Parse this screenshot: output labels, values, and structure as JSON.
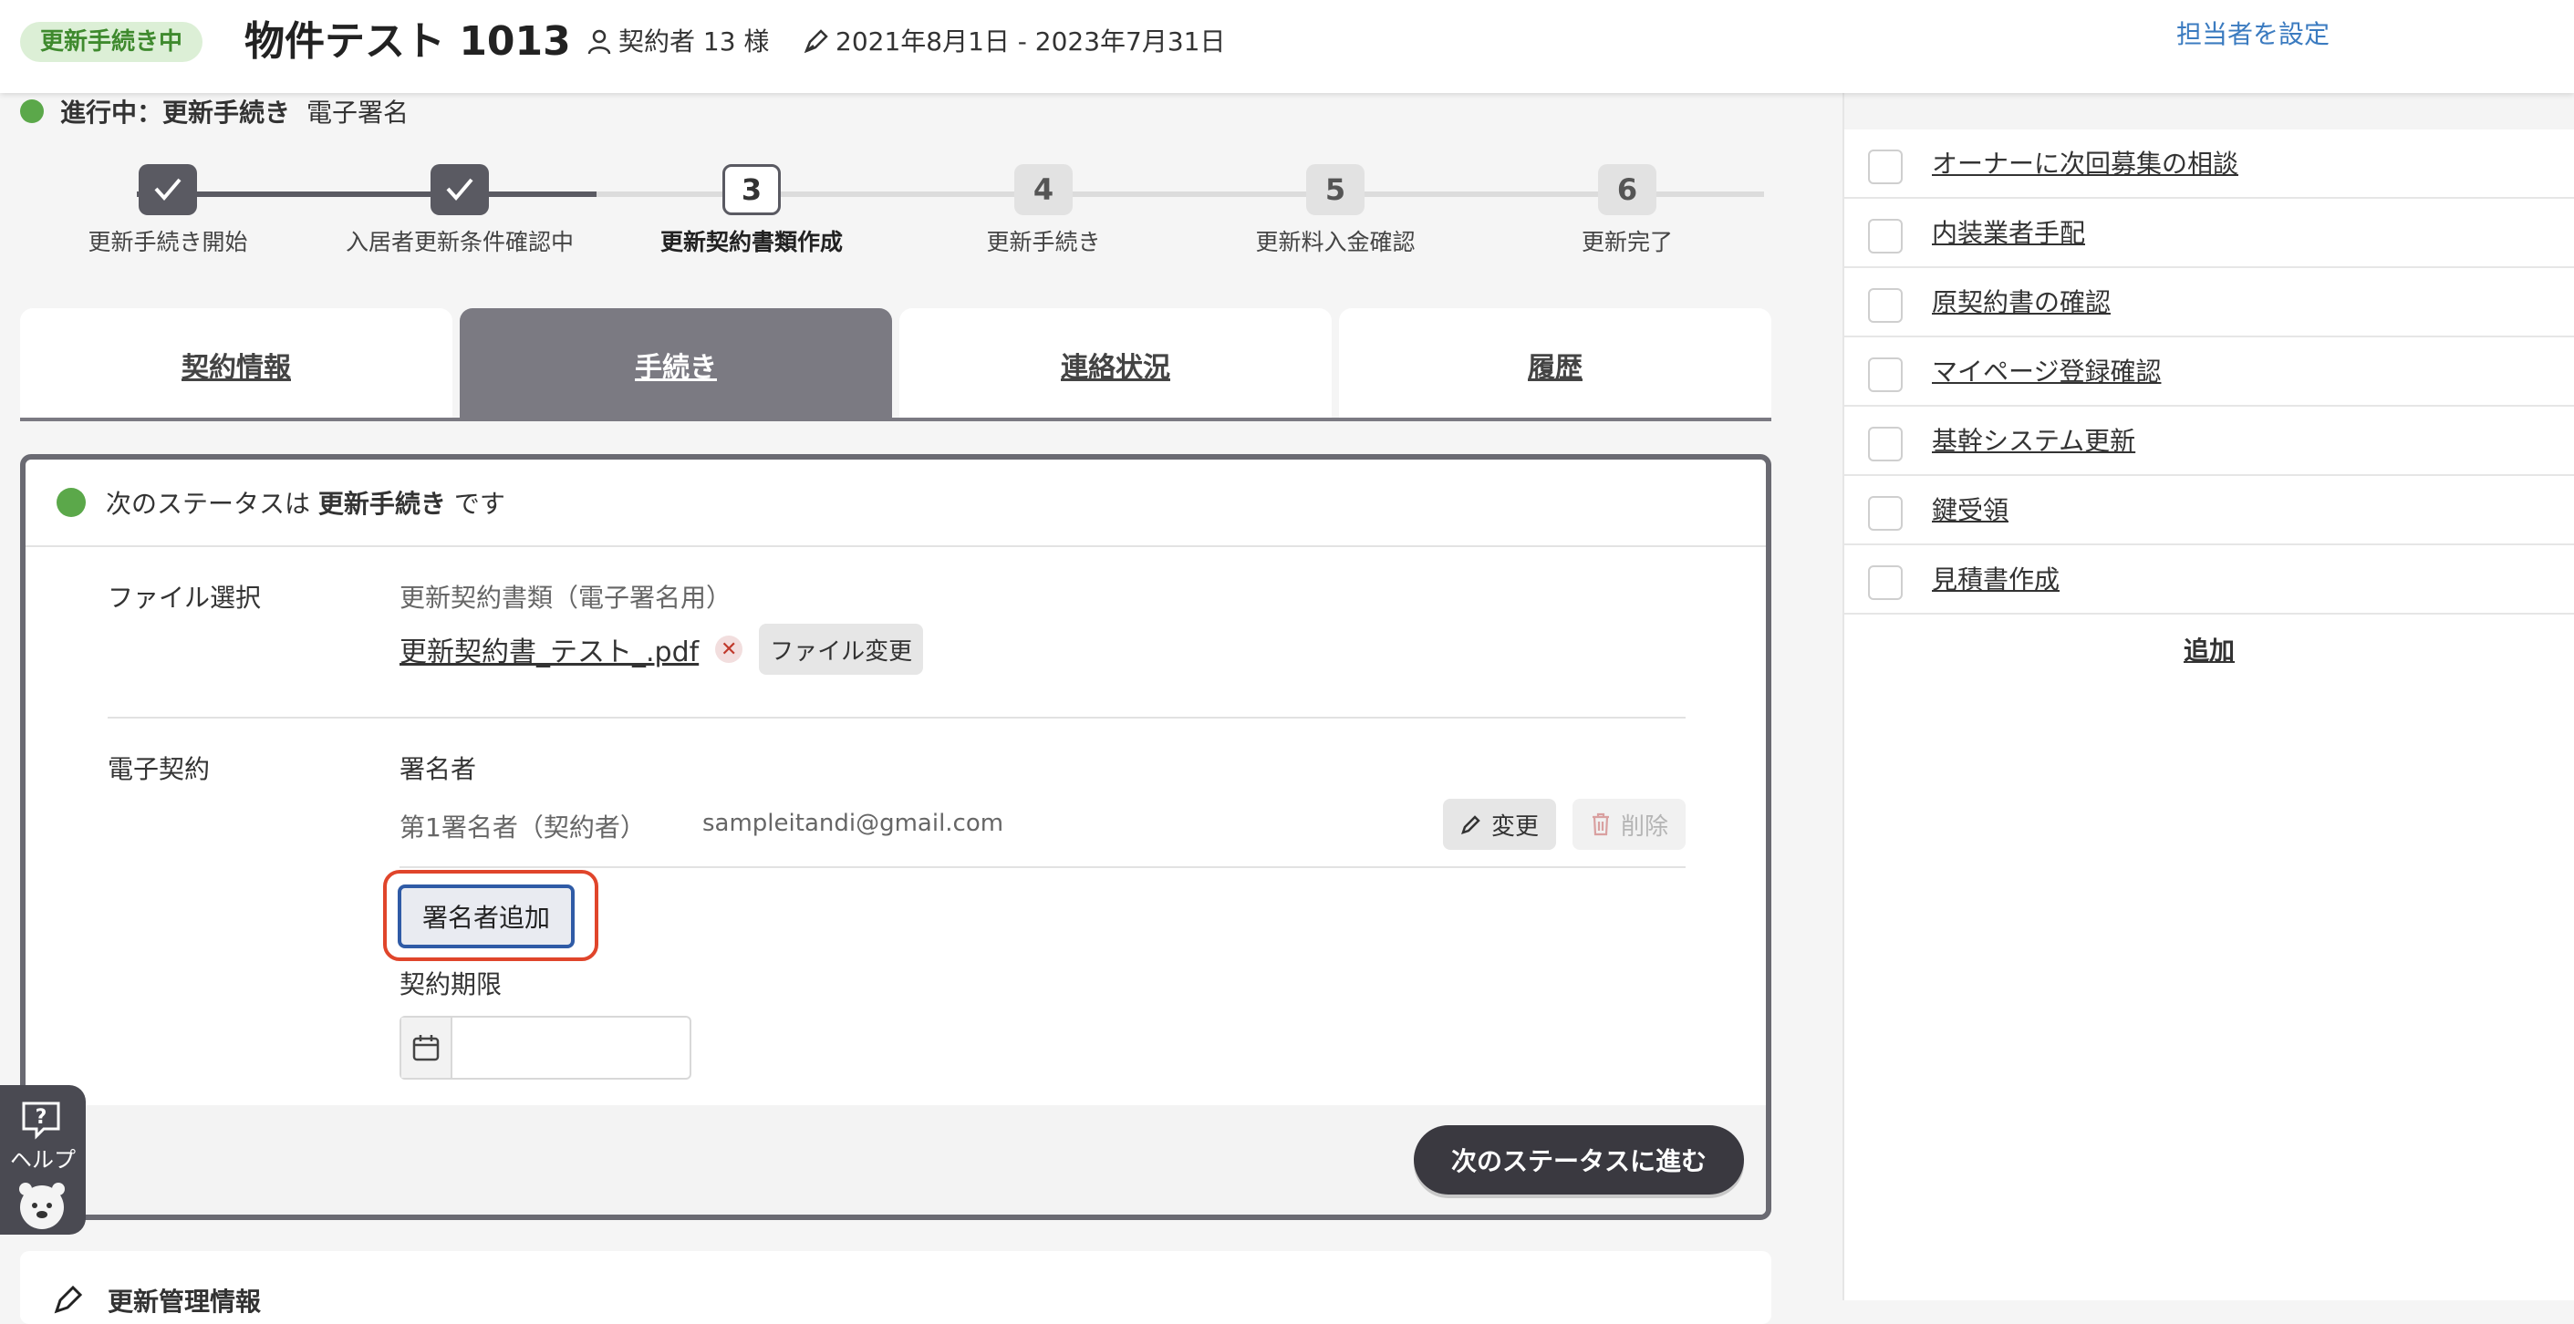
{
  "header": {
    "status_badge": "更新手続き中",
    "title": "物件テスト 1013",
    "tenant": "契約者 13 様",
    "period": "2021年8月1日 - 2023年7月31日",
    "assign_link": "担当者を設定"
  },
  "progress": {
    "label": "進行中：更新手続き",
    "sub": "電子署名"
  },
  "steps": [
    {
      "num": "1",
      "label": "更新手続き開始",
      "state": "done"
    },
    {
      "num": "2",
      "label": "入居者更新条件確認中",
      "state": "done"
    },
    {
      "num": "3",
      "label": "更新契約書類作成",
      "state": "current"
    },
    {
      "num": "4",
      "label": "更新手続き",
      "state": "todo"
    },
    {
      "num": "5",
      "label": "更新料入金確認",
      "state": "todo"
    },
    {
      "num": "6",
      "label": "更新完了",
      "state": "todo"
    }
  ],
  "tabs": [
    {
      "label": "契約情報"
    },
    {
      "label": "手続き"
    },
    {
      "label": "連絡状況"
    },
    {
      "label": "履歴"
    }
  ],
  "panel": {
    "next_status_prefix": "次のステータスは",
    "next_status_value": "更新手続き",
    "next_status_suffix": "です",
    "file_select_label": "ファイル選択",
    "file_type": "更新契約書類（電子署名用）",
    "file_name": "更新契約書_テスト_.pdf",
    "file_change_btn": "ファイル変更",
    "econtract_label": "電子契約",
    "signers_label": "署名者",
    "signer1_role": "第1署名者（契約者）",
    "signer1_email": "sampleitandi@gmail.com",
    "edit_btn": "変更",
    "delete_btn": "削除",
    "add_signer_btn": "署名者追加",
    "deadline_label": "契約期限",
    "deadline_value": "",
    "next_btn": "次のステータスに進む"
  },
  "help": {
    "label": "ヘルプ"
  },
  "bottom_card": {
    "title": "更新管理情報"
  },
  "sidebar": {
    "tasks": [
      {
        "label": "オーナーに次回募集の相談"
      },
      {
        "label": "内装業者手配"
      },
      {
        "label": "原契約書の確認"
      },
      {
        "label": "マイページ登録確認"
      },
      {
        "label": "基幹システム更新"
      },
      {
        "label": "鍵受領"
      },
      {
        "label": "見積書作成"
      }
    ],
    "add_label": "追加"
  },
  "colors": {
    "accent_green": "#5ba84a",
    "dark_grey": "#5a5a62",
    "highlight_red": "#e0452b",
    "link_blue": "#3b7bc0"
  }
}
